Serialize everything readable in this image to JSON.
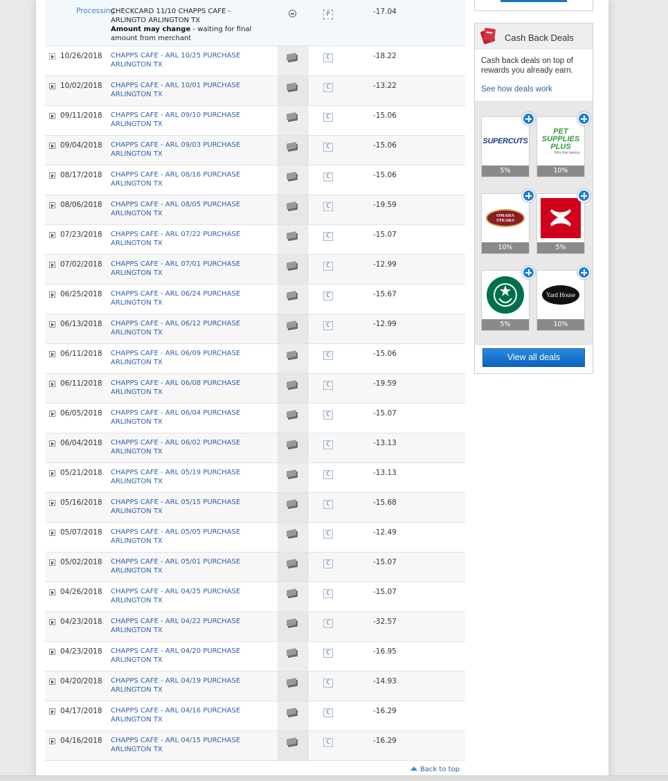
{
  "transactions": {
    "processing": {
      "status": "Processing",
      "line1": "CHECKCARD 11/10 CHAPPS CAFE -",
      "line2": "ARLINGTO ARLINGTON TX",
      "bold_note": "Amount may change",
      "note": " - waiting for final amount from merchant",
      "type_icon": "minus-circle-icon",
      "pending_icon": "p-icon",
      "amount": "-17.04"
    },
    "rows": [
      {
        "date": "10/26/2018",
        "line1": "CHAPPS CAFE - ARL 10/25 PURCHASE",
        "line2": "ARLINGTON TX",
        "amount": "-18.22"
      },
      {
        "date": "10/02/2018",
        "line1": "CHAPPS CAFE - ARL 10/01 PURCHASE",
        "line2": "ARLINGTON TX",
        "amount": "-13.22"
      },
      {
        "date": "09/11/2018",
        "line1": "CHAPPS CAFE - ARL 09/10 PURCHASE",
        "line2": "ARLINGTON TX",
        "amount": "-15.06"
      },
      {
        "date": "09/04/2018",
        "line1": "CHAPPS CAFE - ARL 09/03 PURCHASE",
        "line2": "ARLINGTON TX",
        "amount": "-15.06"
      },
      {
        "date": "08/17/2018",
        "line1": "CHAPPS CAFE - ARL 08/16 PURCHASE",
        "line2": "ARLINGTON TX",
        "amount": "-15.06"
      },
      {
        "date": "08/06/2018",
        "line1": "CHAPPS CAFE - ARL 08/05 PURCHASE",
        "line2": "ARLINGTON TX",
        "amount": "-19.59"
      },
      {
        "date": "07/23/2018",
        "line1": "CHAPPS CAFE - ARL 07/22 PURCHASE",
        "line2": "ARLINGTON TX",
        "amount": "-15.07"
      },
      {
        "date": "07/02/2018",
        "line1": "CHAPPS CAFE - ARL 07/01 PURCHASE",
        "line2": "ARLINGTON TX",
        "amount": "-12.99"
      },
      {
        "date": "06/25/2018",
        "line1": "CHAPPS CAFE - ARL 06/24 PURCHASE",
        "line2": "ARLINGTON TX",
        "amount": "-15.67"
      },
      {
        "date": "06/13/2018",
        "line1": "CHAPPS CAFE - ARL 06/12 PURCHASE",
        "line2": "ARLINGTON TX",
        "amount": "-12.99"
      },
      {
        "date": "06/11/2018",
        "line1": "CHAPPS CAFE - ARL 06/09 PURCHASE",
        "line2": "ARLINGTON TX",
        "amount": "-15.06"
      },
      {
        "date": "06/11/2018",
        "line1": "CHAPPS CAFE - ARL 06/08 PURCHASE",
        "line2": "ARLINGTON TX",
        "amount": "-19.59"
      },
      {
        "date": "06/05/2018",
        "line1": "CHAPPS CAFE - ARL 06/04 PURCHASE",
        "line2": "ARLINGTON TX",
        "amount": "-15.07"
      },
      {
        "date": "06/04/2018",
        "line1": "CHAPPS CAFE - ARL 06/02 PURCHASE",
        "line2": "ARLINGTON TX",
        "amount": "-13.13"
      },
      {
        "date": "05/21/2018",
        "line1": "CHAPPS CAFE - ARL 05/19 PURCHASE",
        "line2": "ARLINGTON TX",
        "amount": "-13.13"
      },
      {
        "date": "05/16/2018",
        "line1": "CHAPPS CAFE - ARL 05/15 PURCHASE",
        "line2": "ARLINGTON TX",
        "amount": "-15.68"
      },
      {
        "date": "05/07/2018",
        "line1": "CHAPPS CAFE - ARL 05/05 PURCHASE",
        "line2": "ARLINGTON TX",
        "amount": "-12.49"
      },
      {
        "date": "05/02/2018",
        "line1": "CHAPPS CAFE - ARL 05/01 PURCHASE",
        "line2": "ARLINGTON TX",
        "amount": "-15.07"
      },
      {
        "date": "04/26/2018",
        "line1": "CHAPPS CAFE - ARL 04/25 PURCHASE",
        "line2": "ARLINGTON TX",
        "amount": "-15.07"
      },
      {
        "date": "04/23/2018",
        "line1": "CHAPPS CAFE - ARL 04/22 PURCHASE",
        "line2": "ARLINGTON TX",
        "amount": "-32.57"
      },
      {
        "date": "04/23/2018",
        "line1": "CHAPPS CAFE - ARL 04/20 PURCHASE",
        "line2": "ARLINGTON TX",
        "amount": "-16.95"
      },
      {
        "date": "04/20/2018",
        "line1": "CHAPPS CAFE - ARL 04/19 PURCHASE",
        "line2": "ARLINGTON TX",
        "amount": "-14.93"
      },
      {
        "date": "04/17/2018",
        "line1": "CHAPPS CAFE - ARL 04/16 PURCHASE",
        "line2": "ARLINGTON TX",
        "amount": "-16.29"
      },
      {
        "date": "04/16/2018",
        "line1": "CHAPPS CAFE - ARL 04/15 PURCHASE",
        "line2": "ARLINGTON TX",
        "amount": "-16.29"
      }
    ],
    "row_icons": {
      "type": "debit-card-icon",
      "category": "c-icon"
    },
    "category_glyph": "C",
    "pending_glyph": "P"
  },
  "footer": {
    "back_to_top": "Back to top"
  },
  "cash_back": {
    "title": "Cash Back Deals",
    "description": "Cash back deals on top of rewards you already earn.",
    "link": "See how deals work",
    "view_all": "View all deals",
    "accent": "#1f7fd6",
    "deals": [
      {
        "name": "Supercuts",
        "logo_text": "SUPERCUTS",
        "percent": "5%"
      },
      {
        "name": "Pet Supplies Plus",
        "logo_text": "PET SUPPLIES PLUS",
        "tagline": "Hits the basics.",
        "percent": "10%"
      },
      {
        "name": "Omaha Steaks",
        "logo_text": "OMAHA STEAKS",
        "percent": "10%"
      },
      {
        "name": "Under Armour",
        "logo_text": "",
        "percent": "5%"
      },
      {
        "name": "Starbucks",
        "logo_text": "",
        "percent": "5%"
      },
      {
        "name": "Yard House",
        "logo_text": "Yard House",
        "percent": "10%"
      }
    ]
  }
}
